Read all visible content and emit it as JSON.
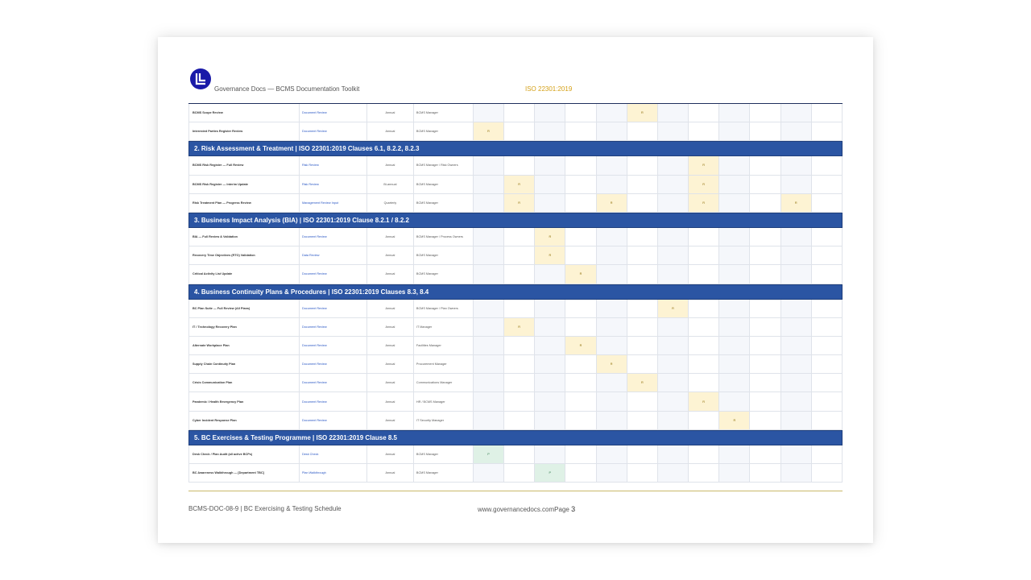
{
  "header": {
    "brand": "Governance Docs — BCMS Documentation Toolkit",
    "standard": "ISO 22301:2019",
    "logo_color": "#1a1aa8"
  },
  "colors": {
    "section_bar": "#2b55a3",
    "review_marker": "#fdf3d3",
    "exercise_marker": "#dff1e6",
    "link_text": "#2a57c4"
  },
  "table": {
    "month_column_count": 12,
    "blocks": [
      {
        "kind": "row",
        "name": "BCMS Scope Review",
        "type": "Document Review",
        "freq": "Annual",
        "owner": "BCMS Manager",
        "markers": [
          {
            "col": 5,
            "label": "R",
            "kind": "review"
          }
        ]
      },
      {
        "kind": "row",
        "name": "Interested Parties Register Review",
        "type": "Document Review",
        "freq": "Annual",
        "owner": "BCMS Manager",
        "markers": [
          {
            "col": 0,
            "label": "R",
            "kind": "review"
          }
        ]
      },
      {
        "kind": "section",
        "title": "2.  Risk Assessment & Treatment  |  ISO 22301:2019 Clauses 6.1, 8.2.2, 8.2.3"
      },
      {
        "kind": "row",
        "name": "BCMS Risk Register — Full Review",
        "type": "Risk Review",
        "freq": "Annual",
        "owner": "BCMS Manager / Risk Owners",
        "markers": [
          {
            "col": 7,
            "label": "R",
            "kind": "review"
          }
        ]
      },
      {
        "kind": "row",
        "name": "BCMS Risk Register — Interim Update",
        "type": "Risk Review",
        "freq": "Bi-annual",
        "owner": "BCMS Manager",
        "markers": [
          {
            "col": 1,
            "label": "R",
            "kind": "review"
          },
          {
            "col": 7,
            "label": "R",
            "kind": "review"
          }
        ]
      },
      {
        "kind": "row",
        "name": "Risk Treatment Plan — Progress Review",
        "type": "Management Review Input",
        "freq": "Quarterly",
        "owner": "BCMS Manager",
        "markers": [
          {
            "col": 1,
            "label": "R",
            "kind": "review"
          },
          {
            "col": 4,
            "label": "R",
            "kind": "review"
          },
          {
            "col": 7,
            "label": "R",
            "kind": "review"
          },
          {
            "col": 10,
            "label": "R",
            "kind": "review"
          }
        ]
      },
      {
        "kind": "section",
        "title": "3.  Business Impact Analysis (BIA)  |  ISO 22301:2019 Clause 8.2.1 / 8.2.2"
      },
      {
        "kind": "row",
        "name": "BIA — Full Review & Validation",
        "type": "Document Review",
        "freq": "Annual",
        "owner": "BCMS Manager / Process Owners",
        "markers": [
          {
            "col": 2,
            "label": "R",
            "kind": "review"
          }
        ]
      },
      {
        "kind": "row",
        "name": "Recovery Time Objectives (RTO) Validation",
        "type": "Data Review",
        "freq": "Annual",
        "owner": "BCMS Manager",
        "markers": [
          {
            "col": 2,
            "label": "R",
            "kind": "review"
          }
        ]
      },
      {
        "kind": "row",
        "name": "Critical Activity List Update",
        "type": "Document Review",
        "freq": "Annual",
        "owner": "BCMS Manager",
        "markers": [
          {
            "col": 3,
            "label": "R",
            "kind": "review"
          }
        ]
      },
      {
        "kind": "section",
        "title": "4.  Business Continuity Plans & Procedures  |  ISO 22301:2019 Clauses 8.3, 8.4"
      },
      {
        "kind": "row",
        "name": "BC Plan Suite — Full Review (All Plans)",
        "type": "Document Review",
        "freq": "Annual",
        "owner": "BCMS Manager / Plan Owners",
        "markers": [
          {
            "col": 6,
            "label": "R",
            "kind": "review"
          }
        ]
      },
      {
        "kind": "row",
        "name": "IT / Technology Recovery Plan",
        "type": "Document Review",
        "freq": "Annual",
        "owner": "IT Manager",
        "markers": [
          {
            "col": 1,
            "label": "R",
            "kind": "review"
          }
        ]
      },
      {
        "kind": "row",
        "name": "Alternate Workplace Plan",
        "type": "Document Review",
        "freq": "Annual",
        "owner": "Facilities Manager",
        "markers": [
          {
            "col": 3,
            "label": "R",
            "kind": "review"
          }
        ]
      },
      {
        "kind": "row",
        "name": "Supply Chain Continuity Plan",
        "type": "Document Review",
        "freq": "Annual",
        "owner": "Procurement Manager",
        "markers": [
          {
            "col": 4,
            "label": "R",
            "kind": "review"
          }
        ]
      },
      {
        "kind": "row",
        "name": "Crisis Communication Plan",
        "type": "Document Review",
        "freq": "Annual",
        "owner": "Communications Manager",
        "markers": [
          {
            "col": 5,
            "label": "R",
            "kind": "review"
          }
        ]
      },
      {
        "kind": "row",
        "name": "Pandemic / Health Emergency Plan",
        "type": "Document Review",
        "freq": "Annual",
        "owner": "HR / BCMS Manager",
        "markers": [
          {
            "col": 7,
            "label": "R",
            "kind": "review"
          }
        ]
      },
      {
        "kind": "row",
        "name": "Cyber Incident Response Plan",
        "type": "Document Review",
        "freq": "Annual",
        "owner": "IT Security Manager",
        "markers": [
          {
            "col": 8,
            "label": "R",
            "kind": "review"
          }
        ]
      },
      {
        "kind": "section",
        "title": "5.  BC Exercises & Testing Programme  |  ISO 22301:2019 Clause 8.5"
      },
      {
        "kind": "row",
        "name": "Desk Check / Plan Audit (all active BCPs)",
        "type": "Desk Check",
        "freq": "Annual",
        "owner": "BCMS Manager",
        "markers": [
          {
            "col": 0,
            "label": "P",
            "kind": "exercise"
          }
        ]
      },
      {
        "kind": "row",
        "name": "BC Awareness Walkthrough — [Department TBC]",
        "type": "Plan Walkthrough",
        "freq": "Annual",
        "owner": "BCMS Manager",
        "markers": [
          {
            "col": 2,
            "label": "P",
            "kind": "exercise"
          }
        ]
      }
    ]
  },
  "footer": {
    "doc_id": "BCMS-DOC-08-9  |  BC Exercising & Testing Schedule",
    "website": "www.governancedocs.com",
    "page_label": "Page",
    "page_number": "3"
  }
}
